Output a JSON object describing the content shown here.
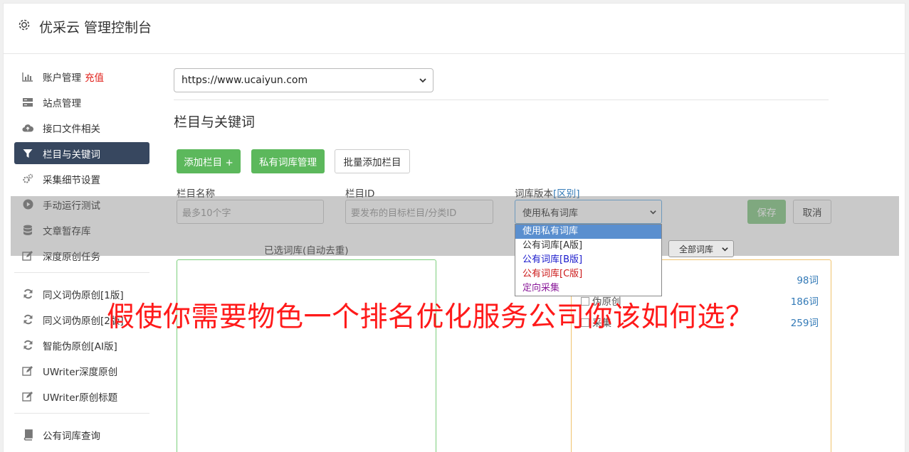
{
  "app": {
    "title": "优采云 管理控制台",
    "icon": "gear-icon"
  },
  "sidebar": {
    "items": [
      {
        "label": "账户管理",
        "extra": "充值",
        "icon": "bar-chart-icon"
      },
      {
        "label": "站点管理",
        "icon": "server-icon"
      },
      {
        "label": "接口文件相关",
        "icon": "cloud-upload-icon"
      },
      {
        "label": "栏目与关键词",
        "icon": "filter-icon",
        "active": true
      },
      {
        "label": "采集细节设置",
        "icon": "cogs-icon"
      },
      {
        "label": "手动运行测试",
        "icon": "play-icon"
      },
      {
        "label": "文章暂存库",
        "icon": "database-icon"
      },
      {
        "label": "深度原创任务",
        "icon": "edit-icon"
      }
    ],
    "items2": [
      {
        "label": "同义词伪原创[1版]",
        "icon": "refresh-icon"
      },
      {
        "label": "同义词伪原创[2版]",
        "icon": "refresh-icon"
      },
      {
        "label": "智能伪原创[AI版]",
        "icon": "refresh-icon"
      },
      {
        "label": "UWriter深度原创",
        "icon": "edit-icon"
      },
      {
        "label": "UWriter原创标题",
        "icon": "edit-icon"
      }
    ],
    "items3": [
      {
        "label": "公有词库查询",
        "icon": "book-icon"
      }
    ]
  },
  "main": {
    "site_select": "https://www.ucaiyun.com",
    "section_title": "栏目与关键词",
    "buttons": {
      "add_column": "添加栏目 +",
      "private_lib": "私有词库管理",
      "batch_add": "批量添加栏目"
    },
    "form": {
      "name_label": "栏目名称",
      "name_placeholder": "最多10个字",
      "id_label": "栏目ID",
      "id_placeholder": "要发布的目标栏目/分类ID",
      "version_label": "词库版本",
      "version_link": "[区别]",
      "version_value": "使用私有词库",
      "save": "保存",
      "cancel": "取消"
    },
    "dropdown": {
      "options": [
        {
          "label": "使用私有词库",
          "color": "#ffffff"
        },
        {
          "label": "公有词库[A版]",
          "color": "#333333"
        },
        {
          "label": "公有词库[B版]",
          "color": "#1a1acc"
        },
        {
          "label": "公有词库[C版]",
          "color": "#cc1a1a"
        },
        {
          "label": "定向采集",
          "color": "#8a1a9a"
        }
      ]
    },
    "selected_label": "已选词库(自动去重)",
    "all_libs": "全部词库",
    "libs": [
      {
        "name": "",
        "count": "98词"
      },
      {
        "name": "伪原创",
        "count": "186词"
      },
      {
        "name": "采集",
        "count": "259词"
      }
    ]
  },
  "banner": "假使你需要物色一个排名优化服务公司你该如何选？",
  "colors": {
    "green": "#5cb85c",
    "active_nav": "#37475f",
    "recharge": "#e0201a",
    "banner": "#ff1a1a"
  }
}
